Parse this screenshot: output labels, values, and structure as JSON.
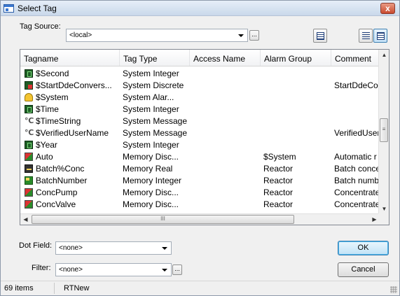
{
  "window": {
    "title": "Select Tag",
    "close": "x"
  },
  "tag_source": {
    "label": "Tag Source:",
    "value": "<local>",
    "browse": "..."
  },
  "list": {
    "columns": [
      "Tagname",
      "Tag Type",
      "Access Name",
      "Alarm Group",
      "Comment"
    ],
    "rows": [
      {
        "icon": "discrete-green-icon",
        "name": "$Second",
        "type": "System Integer",
        "access": "",
        "alarm": "",
        "comment": ""
      },
      {
        "icon": "discrete-red-icon",
        "name": "$StartDdeConvers...",
        "type": "System Discrete",
        "access": "",
        "alarm": "",
        "comment": "StartDdeCon"
      },
      {
        "icon": "alarm-bell-icon",
        "name": "$System",
        "type": "System Alar...",
        "access": "",
        "alarm": "",
        "comment": ""
      },
      {
        "icon": "discrete-green-icon",
        "name": "$Time",
        "type": "System Integer",
        "access": "",
        "alarm": "",
        "comment": ""
      },
      {
        "icon": "message-icon",
        "name": "$TimeString",
        "type": "System Message",
        "access": "",
        "alarm": "",
        "comment": ""
      },
      {
        "icon": "message-icon",
        "name": "$VerifiedUserName",
        "type": "System Message",
        "access": "",
        "alarm": "",
        "comment": "VerifiedUser"
      },
      {
        "icon": "discrete-green-icon",
        "name": "$Year",
        "type": "System Integer",
        "access": "",
        "alarm": "",
        "comment": ""
      },
      {
        "icon": "memory-discrete-icon",
        "name": "Auto",
        "type": "Memory Disc...",
        "access": "",
        "alarm": "$System",
        "comment": "Automatic r"
      },
      {
        "icon": "memory-real-icon",
        "name": "Batch%Conc",
        "type": "Memory Real",
        "access": "",
        "alarm": "Reactor",
        "comment": "Batch conce"
      },
      {
        "icon": "memory-integer-icon",
        "name": "BatchNumber",
        "type": "Memory Integer",
        "access": "",
        "alarm": "Reactor",
        "comment": "Batch numb"
      },
      {
        "icon": "memory-discrete-icon",
        "name": "ConcPump",
        "type": "Memory Disc...",
        "access": "",
        "alarm": "Reactor",
        "comment": "Concentrate"
      },
      {
        "icon": "memory-discrete-icon",
        "name": "ConcValve",
        "type": "Memory Disc...",
        "access": "",
        "alarm": "Reactor",
        "comment": "Concentrate"
      }
    ],
    "hscroll_grip": "III",
    "vscroll_grip": "≡"
  },
  "dot_field": {
    "label": "Dot Field:",
    "value": "<none>"
  },
  "filter": {
    "label": "Filter:",
    "value": "<none>",
    "browse": "..."
  },
  "buttons": {
    "ok": "OK",
    "cancel": "Cancel"
  },
  "status": {
    "count": "69 items",
    "db": "RTNew"
  }
}
